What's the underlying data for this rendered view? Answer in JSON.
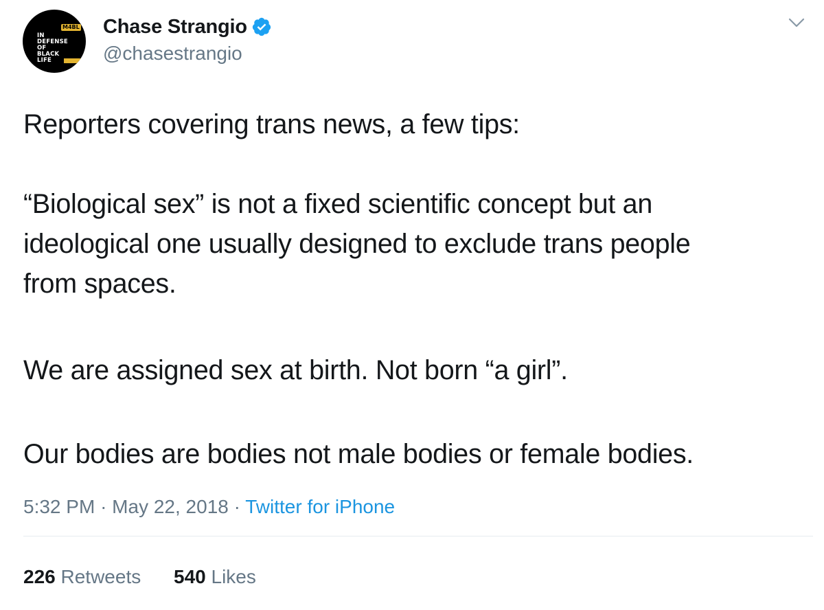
{
  "user": {
    "display_name": "Chase Strangio",
    "handle": "@chasestrangio",
    "verified": true,
    "avatar_lines": [
      "IN",
      "DEFENSE",
      "OF",
      "BLACK",
      "LIFE"
    ],
    "avatar_badge": "M4BL"
  },
  "tweet": {
    "lines": [
      "Reporters covering trans news, a few tips:",
      "“Biological sex” is not a fixed scientific concept but an",
      "ideological one usually designed to exclude trans people",
      "from spaces.",
      "We are assigned sex at birth. Not born “a girl”.",
      "Our bodies are bodies not male bodies or female bodies."
    ]
  },
  "meta": {
    "time": "5:32 PM",
    "date": "May 22, 2018",
    "source": "Twitter for iPhone",
    "separator": "·"
  },
  "stats": {
    "retweets_count": "226",
    "retweets_label": "Retweets",
    "likes_count": "540",
    "likes_label": "Likes"
  },
  "colors": {
    "accent": "#1b95e0",
    "verified": "#1da1f2",
    "secondary_text": "#657786",
    "primary_text": "#14171a"
  },
  "icons": {
    "verified": "verified-badge-icon",
    "menu": "chevron-down-icon"
  }
}
